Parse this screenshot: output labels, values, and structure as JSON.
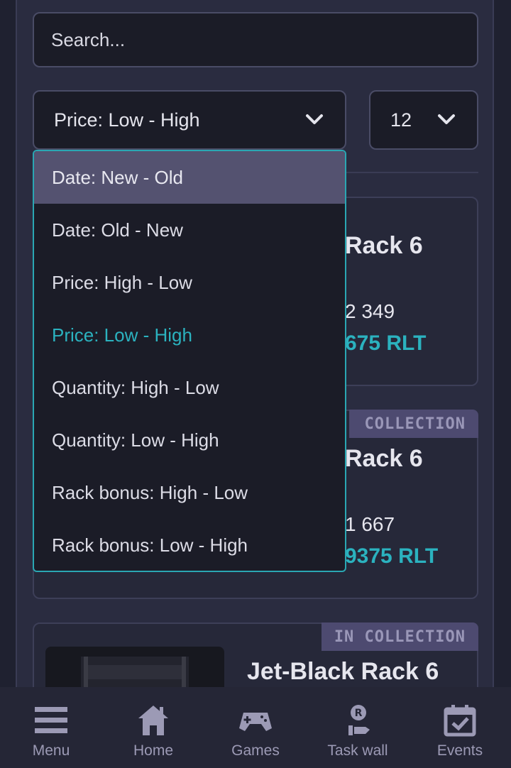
{
  "search": {
    "placeholder": "Search..."
  },
  "sort": {
    "selected": "Price: Low - High",
    "options": [
      "Date: New - Old",
      "Date: Old - New",
      "Price: High - Low",
      "Price: Low - High",
      "Quantity: High - Low",
      "Quantity: Low - High",
      "Rack bonus: High - Low",
      "Rack bonus: Low - High"
    ]
  },
  "per_page": {
    "selected": "12"
  },
  "cards": [
    {
      "title": "Rack 6",
      "qty": "2 349",
      "price": "675 RLT",
      "badge": ""
    },
    {
      "title": "Rack 6",
      "qty": "1 667",
      "price": "9375 RLT",
      "badge": "COLLECTION"
    },
    {
      "title": "Jet-Black Rack 6",
      "qty": "",
      "price": "",
      "badge": "IN COLLECTION"
    }
  ],
  "nav": [
    {
      "label": "Menu",
      "icon": "menu-icon"
    },
    {
      "label": "Home",
      "icon": "home-icon"
    },
    {
      "label": "Games",
      "icon": "gamepad-icon"
    },
    {
      "label": "Task wall",
      "icon": "task-wall-icon"
    },
    {
      "label": "Events",
      "icon": "calendar-icon"
    }
  ],
  "colors": {
    "accent": "#2bb2bf",
    "highlight": "#545270",
    "nav_icon": "#9c9ab5"
  }
}
